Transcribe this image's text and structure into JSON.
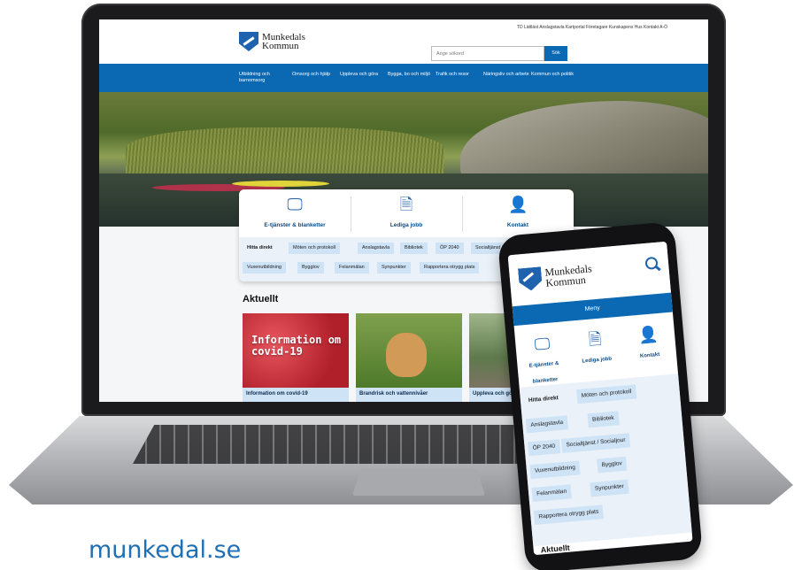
{
  "site": {
    "logo_line1": "Munkedals",
    "logo_line2": "Kommun",
    "top_links": "TD  Lättläst  Anslagstavla  Kartportal  Företagare  Kunskapens Hus  Kontakt  A-Ö",
    "search_placeholder": "Ange sökord",
    "search_button": "Sök"
  },
  "nav": [
    "Utbildning och barnomsorg",
    "Omsorg och hjälp",
    "Uppleva och göra",
    "Bygga, bo och miljö",
    "Trafik och resor",
    "Näringsliv och arbete",
    "Kommun och politik"
  ],
  "quick": {
    "e_services": "E-tjänster & blanketter",
    "jobs": "Lediga jobb",
    "contact": "Kontakt"
  },
  "direct": {
    "title": "Hitta direkt",
    "links": [
      "Möten och protokoll",
      "Anslagstavla",
      "Bibliotek",
      "ÖP 2040",
      "Socialtjänst / Socialjour",
      "Vuxenutbildning",
      "Bygglov",
      "Felanmälan",
      "Synpunkter",
      "Rapportera otrygg plats"
    ]
  },
  "aktuellt": {
    "title": "Aktuellt",
    "cards": [
      {
        "image_text": "Information om covid-19",
        "caption": "Information om covid-19"
      },
      {
        "caption": "Brandrisk och vattennivåer"
      },
      {
        "caption": "Uppleva och göra"
      }
    ]
  },
  "phone": {
    "menu": "Meny",
    "e_services": "E-tjänster & blanketter",
    "aktuellt_partial": "Aktuellt"
  },
  "footer_url": "munkedal.se",
  "colors": {
    "brand_blue": "#0b68b3",
    "chip_blue": "#cfe3f6",
    "url_blue": "#1f6fb5"
  }
}
